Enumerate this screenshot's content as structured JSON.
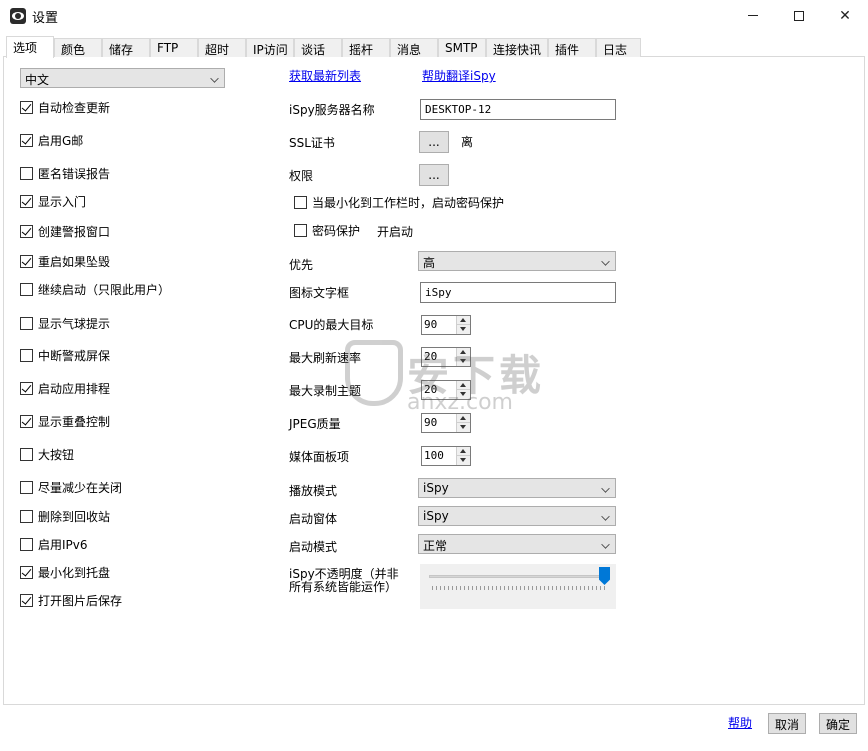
{
  "window": {
    "title": "设置",
    "icon": "ispy-eye-icon",
    "buttons": [
      "minimize-icon",
      "maximize-icon",
      "close-icon"
    ]
  },
  "tabs": [
    {
      "label": "选项",
      "active": true
    },
    {
      "label": "颜色"
    },
    {
      "label": "储存"
    },
    {
      "label": "FTP"
    },
    {
      "label": "超时"
    },
    {
      "label": "IP访问"
    },
    {
      "label": "谈话"
    },
    {
      "label": "摇杆"
    },
    {
      "label": "消息"
    },
    {
      "label": "SMTP"
    },
    {
      "label": "连接快讯"
    },
    {
      "label": "插件"
    },
    {
      "label": "日志"
    }
  ],
  "left": {
    "language": "中文",
    "checkboxes": [
      {
        "label": "自动检查更新",
        "checked": true
      },
      {
        "label": "启用G邮",
        "checked": true
      },
      {
        "label": "匿名错误报告",
        "checked": false
      },
      {
        "label": "显示入门",
        "checked": true
      },
      {
        "label": "创建警报窗口",
        "checked": true
      },
      {
        "label": "重启如果坠毁",
        "checked": true
      },
      {
        "label": "继续启动（只限此用户）",
        "checked": false
      },
      {
        "label": "显示气球提示",
        "checked": false
      },
      {
        "label": "中断警戒屏保",
        "checked": false
      },
      {
        "label": "启动应用排程",
        "checked": true
      },
      {
        "label": "显示重叠控制",
        "checked": true
      },
      {
        "label": "大按钮",
        "checked": false
      },
      {
        "label": "尽量减少在关闭",
        "checked": false
      },
      {
        "label": "删除到回收站",
        "checked": false
      },
      {
        "label": "启用IPv6",
        "checked": false
      },
      {
        "label": "最小化到托盘",
        "checked": true
      },
      {
        "label": "打开图片后保存",
        "checked": true
      }
    ]
  },
  "right": {
    "links": {
      "get_list": "获取最新列表",
      "help_translate": "帮助翻译iSpy"
    },
    "server_name_label": "iSpy服务器名称",
    "server_name_value": "DESKTOP-12",
    "ssl_label": "SSL证书",
    "ssl_button": "...",
    "ssl_status": "离",
    "permissions_label": "权限",
    "permissions_button": "...",
    "password_minimize": {
      "label": "当最小化到工作栏时，启动密码保护",
      "checked": false
    },
    "password_protect": {
      "label": "密码保护",
      "checked": false
    },
    "on_start_label": "开启动",
    "priority_label": "优先",
    "priority_value": "高",
    "icon_text_label": "图标文字框",
    "icon_text_value": "iSpy",
    "cpu_label": "CPU的最大目标",
    "cpu_value": "90",
    "refresh_label": "最大刷新速率",
    "refresh_value": "20",
    "record_label": "最大录制主题",
    "record_value": "20",
    "jpeg_label": "JPEG质量",
    "jpeg_value": "90",
    "media_label": "媒体面板项",
    "media_value": "100",
    "playback_label": "播放模式",
    "playback_value": "iSpy",
    "startup_window_label": "启动窗体",
    "startup_window_value": "iSpy",
    "startup_mode_label": "启动模式",
    "startup_mode_value": "正常",
    "opacity_label_line1": "iSpy不透明度（并非",
    "opacity_label_line2": "所有系统皆能运作）",
    "opacity_value": 1.0
  },
  "watermark": {
    "main": "安下载",
    "sub": "anxz.com"
  },
  "footer": {
    "help": "帮助",
    "cancel": "取消",
    "ok": "确定"
  }
}
